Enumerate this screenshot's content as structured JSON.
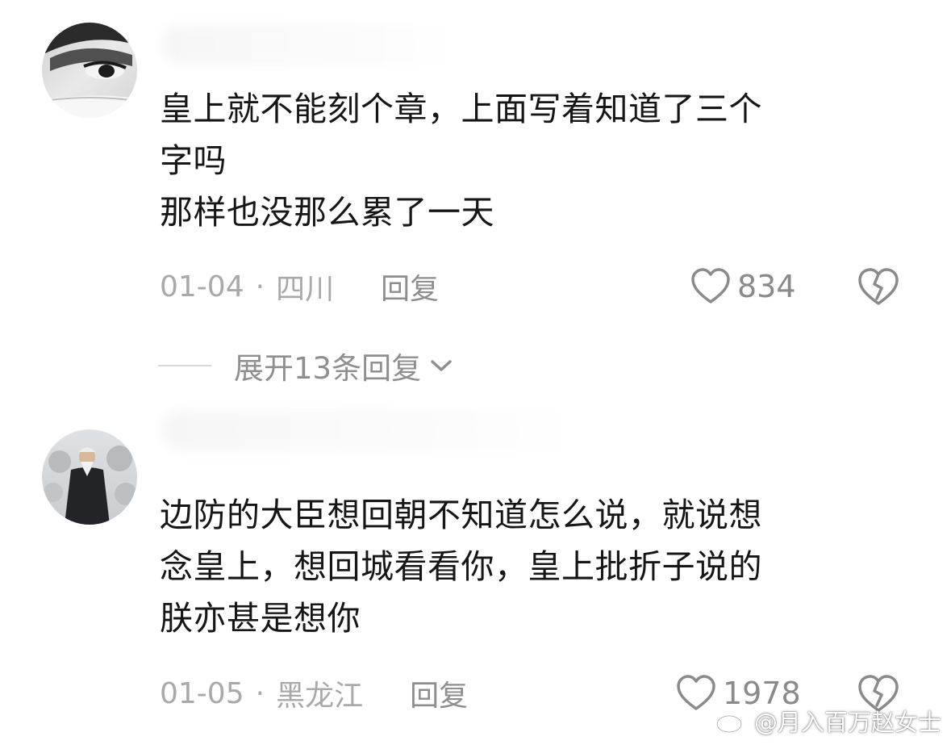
{
  "comments": [
    {
      "lines": [
        "皇上就不能刻个章，上面写着知道了三个",
        "字吗",
        "那样也没那么累了一天"
      ],
      "date": "01-04",
      "separator": "·",
      "location": "四川",
      "reply_label": "回复",
      "likes": "834",
      "avatar_icon": "avatar-face-photo",
      "expand_label": "展开13条回复"
    },
    {
      "lines": [
        "边防的大臣想回朝不知道怎么说，就说想",
        "念皇上，想回城看看你，皇上批折子说的",
        "朕亦甚是想你"
      ],
      "date": "01-05",
      "separator": "·",
      "location": "黑龙江",
      "reply_label": "回复",
      "likes": "1978",
      "avatar_icon": "avatar-old-man-photo"
    }
  ],
  "watermark": {
    "text": "@月入百万赵女士",
    "icon": "weibo-logo-icon"
  },
  "colors": {
    "text": "#161616",
    "meta": "#a9a9a9",
    "icon": "#8a8a8a"
  }
}
